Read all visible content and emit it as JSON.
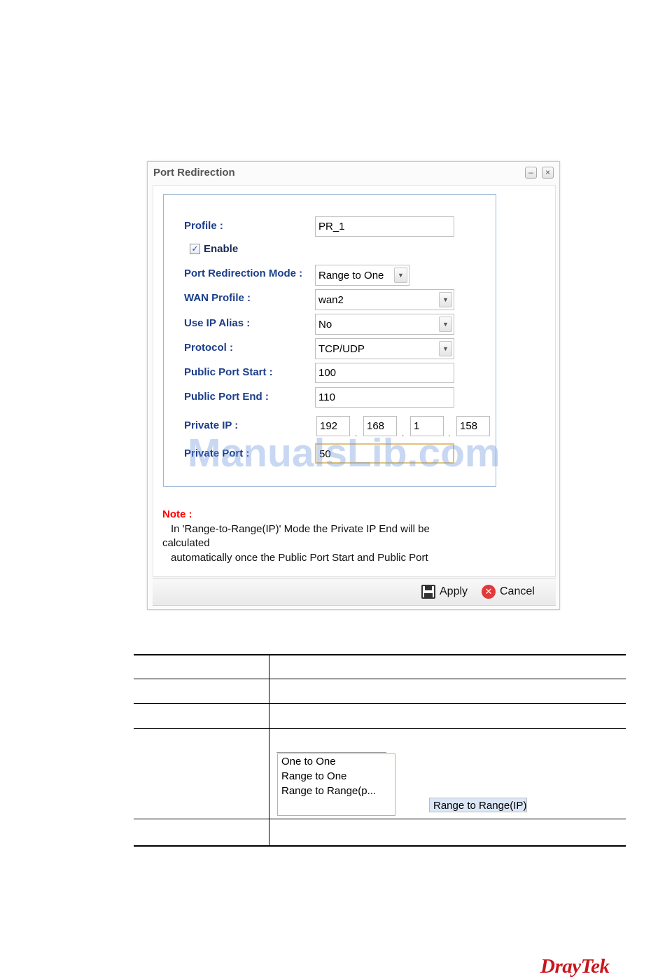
{
  "dialog": {
    "title": "Port Redirection",
    "minimize_glyph": "–",
    "close_glyph": "×",
    "fields": {
      "profile_label": "Profile :",
      "profile_value": "PR_1",
      "enable_label": "Enable",
      "enable_checked": true,
      "mode_label": "Port Redirection Mode :",
      "mode_value": "Range to One",
      "wan_label": "WAN Profile :",
      "wan_value": "wan2",
      "alias_label": "Use IP Alias :",
      "alias_value": "No",
      "protocol_label": "Protocol :",
      "protocol_value": "TCP/UDP",
      "port_start_label": "Public Port Start :",
      "port_start_value": "100",
      "port_end_label": "Public Port End :",
      "port_end_value": "110",
      "private_ip_label": "Private IP :",
      "private_ip": [
        "192",
        "168",
        "1",
        "158"
      ],
      "private_port_label": "Private Port :",
      "private_port_value": "50"
    },
    "note": {
      "title": "Note :",
      "line1": "In 'Range-to-Range(IP)' Mode the Private IP End will be",
      "line2": "calculated",
      "line3": "automatically once the Public Port Start and Public Port"
    },
    "buttons": {
      "apply": "Apply",
      "cancel": "Cancel"
    }
  },
  "watermark": "ManualsLib.com",
  "mode_dropdown": {
    "options": [
      "One to One",
      "Range to One",
      "Range to Range(p...",
      "Range to Range(IP)"
    ],
    "selected_index": 3
  },
  "brand": "DrayTek"
}
